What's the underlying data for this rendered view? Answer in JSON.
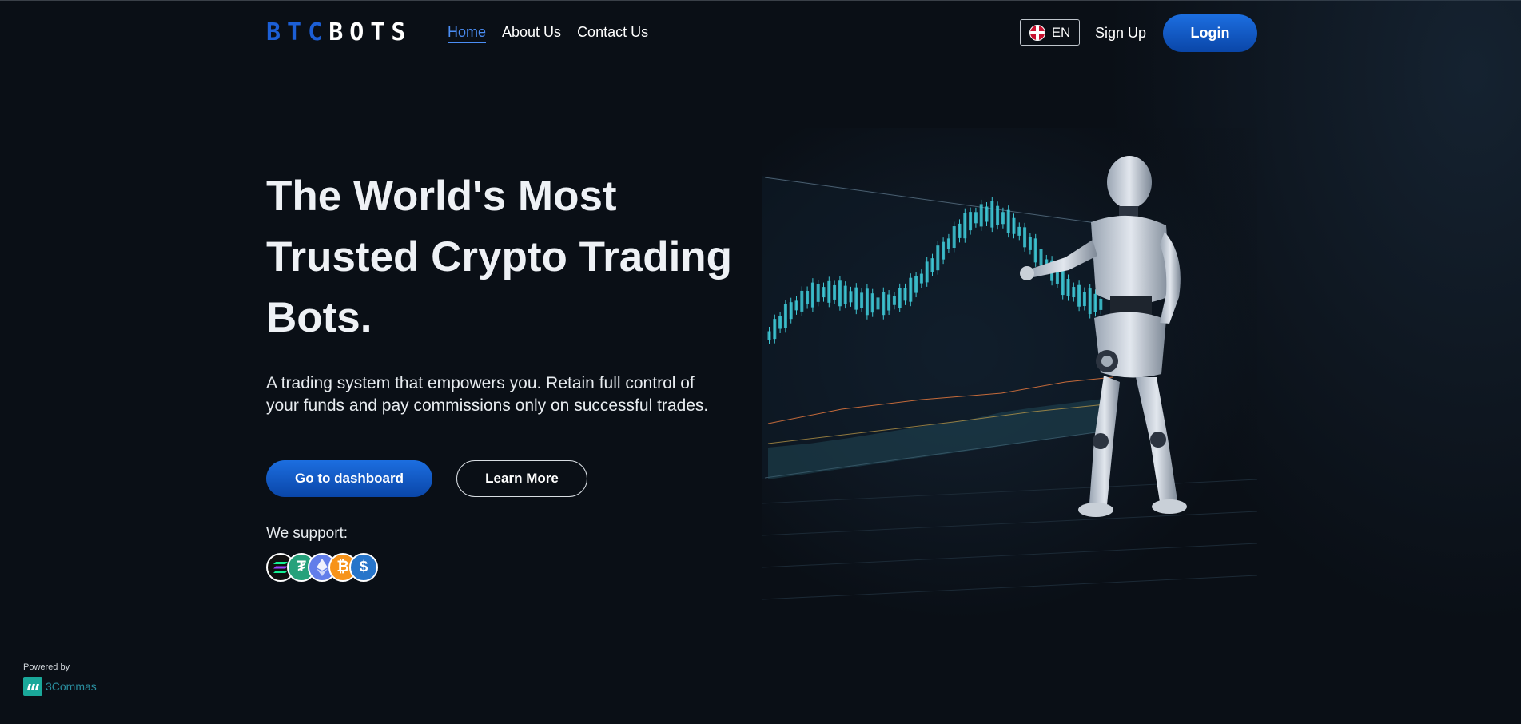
{
  "header": {
    "logo_btc": "BTC",
    "logo_bots": "BOTS",
    "nav": [
      {
        "label": "Home"
      },
      {
        "label": "About Us"
      },
      {
        "label": "Contact Us"
      }
    ],
    "language": "EN",
    "signup_label": "Sign Up",
    "login_label": "Login"
  },
  "hero": {
    "title": "The World's Most Trusted Crypto Trading Bots.",
    "subtitle": "A trading system that empowers you. Retain full control of your funds and pay commissions only on successful trades.",
    "dashboard_button": "Go to dashboard",
    "learn_more_button": "Learn More",
    "support_label": "We support:",
    "coins": [
      {
        "name": "solana-icon",
        "color": "#111111"
      },
      {
        "name": "tether-icon",
        "color": "#26a17b"
      },
      {
        "name": "ethereum-icon",
        "color": "#627eea"
      },
      {
        "name": "bitcoin-icon",
        "color": "#f7931a"
      },
      {
        "name": "usdc-icon",
        "color": "#2775ca"
      }
    ]
  },
  "footer": {
    "powered_by": "Powered by",
    "brand": "3Commas"
  },
  "colors": {
    "accent": "#1c6ee0",
    "background": "#0a0f16",
    "active_nav": "#4b8ef5"
  }
}
